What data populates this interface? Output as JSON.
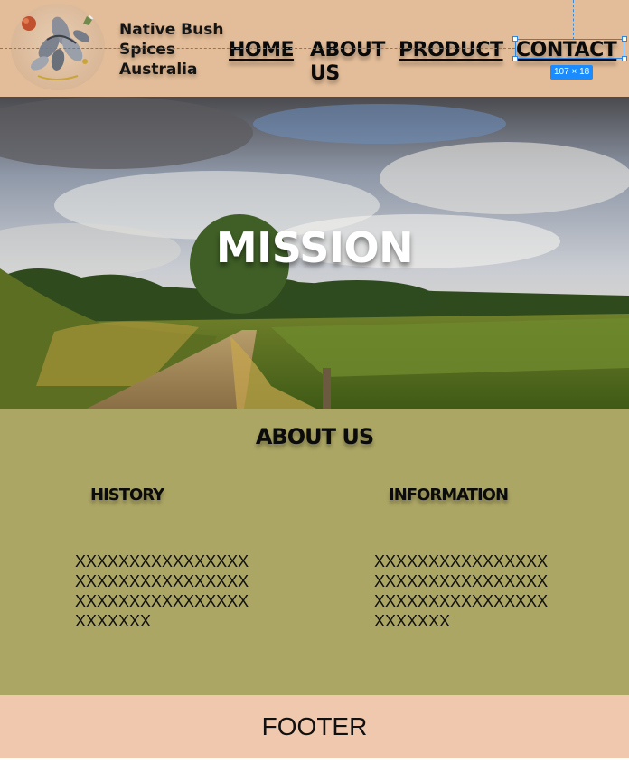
{
  "brand": {
    "name_line1": "Native Bush",
    "name_line2": "Spices",
    "name_line3": "Australia",
    "logo_icon": "spice-pods-logo-icon"
  },
  "nav": {
    "home": "HOME",
    "about": "ABOUT US",
    "product": "PRODUCT",
    "contact": "CONTACT"
  },
  "editor_overlay": {
    "size_badge": "107 × 18"
  },
  "hero": {
    "title": "MISSION",
    "image": "countryside-landscape-photo"
  },
  "about": {
    "title": "ABOUT US",
    "history": {
      "heading": "HISTORY",
      "text": "XXXXXXXXXXXXXXXXXXXXXXXXXXXXXXXXXXXXXXXXXXXXXXXXXXXXXXX"
    },
    "information": {
      "heading": "INFORMATION",
      "text": "XXXXXXXXXXXXXXXXXXXXXXXXXXXXXXXXXXXXXXXXXXXXXXXXXXXXXXX"
    }
  },
  "footer": {
    "label": "FOOTER"
  },
  "colors": {
    "header_bg": "#e3bd99",
    "about_bg": "#aca664",
    "footer_bg": "#efc8ad",
    "selection_blue": "#1a8cff"
  }
}
